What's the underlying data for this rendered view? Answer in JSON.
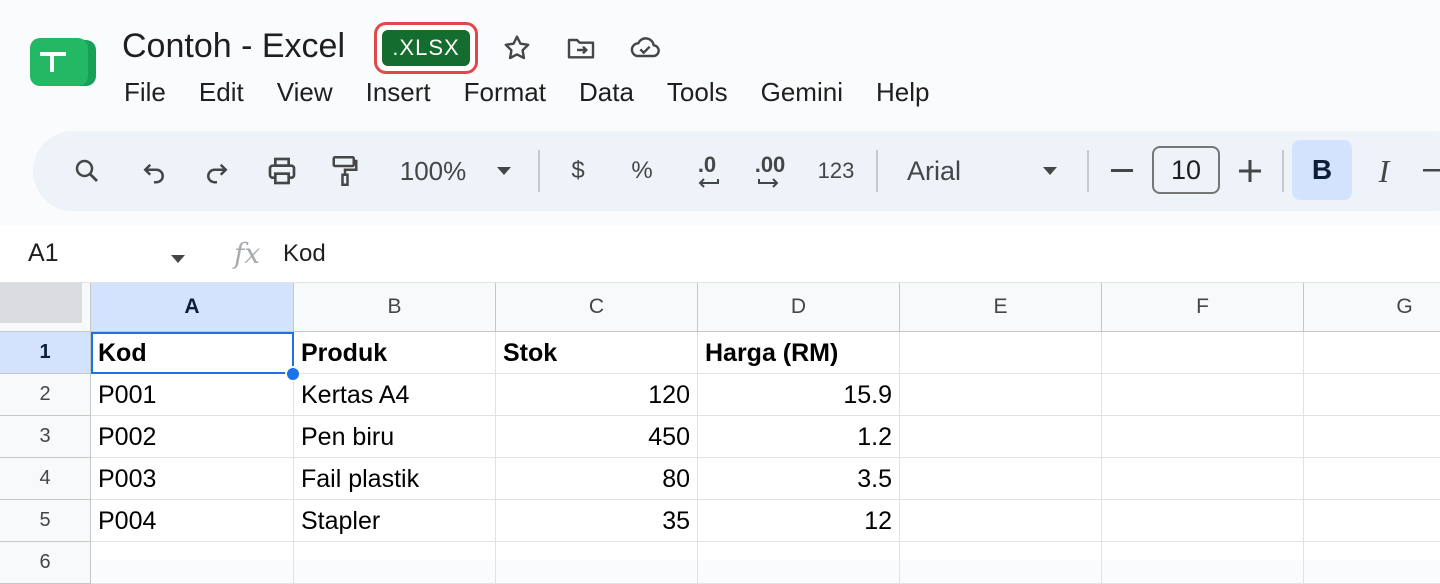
{
  "app": {
    "logo_icon": "sheets-logo-icon",
    "brand_color": "#1ea362"
  },
  "document": {
    "title": "Contoh - Excel",
    "format_badge": ".XLSX",
    "badge_color": "#146c2e",
    "badge_highlight": "#e0484c",
    "icons": [
      "star-icon",
      "move-to-folder-icon",
      "cloud-saved-icon"
    ]
  },
  "menu": {
    "items": [
      "File",
      "Edit",
      "View",
      "Insert",
      "Format",
      "Data",
      "Tools",
      "Gemini",
      "Help"
    ]
  },
  "toolbar": {
    "zoom": "100%",
    "currency": "$",
    "percent": "%",
    "decrease_decimal": ".0",
    "increase_decimal": ".00",
    "more_formats": "123",
    "font": "Arial",
    "font_size": "10",
    "bold": "B",
    "italic": "I",
    "accent": "#d3e3fd"
  },
  "formula_bar": {
    "name_box": "A1",
    "fx": "fx",
    "content": "Kod"
  },
  "grid": {
    "columns": [
      "A",
      "B",
      "C",
      "D",
      "E",
      "F",
      "G"
    ],
    "selected_column": "A",
    "rows": [
      "1",
      "2",
      "3",
      "4",
      "5",
      "6"
    ],
    "selected_row": "1",
    "active_cell": "A1",
    "header": [
      "Kod",
      "Produk",
      "Stok",
      "Harga (RM)"
    ],
    "data": [
      [
        "P001",
        "Kertas A4",
        "120",
        "15.9"
      ],
      [
        "P002",
        "Pen biru",
        "450",
        "1.2"
      ],
      [
        "P003",
        "Fail plastik",
        "80",
        "3.5"
      ],
      [
        "P004",
        "Stapler",
        "35",
        "12"
      ]
    ]
  }
}
